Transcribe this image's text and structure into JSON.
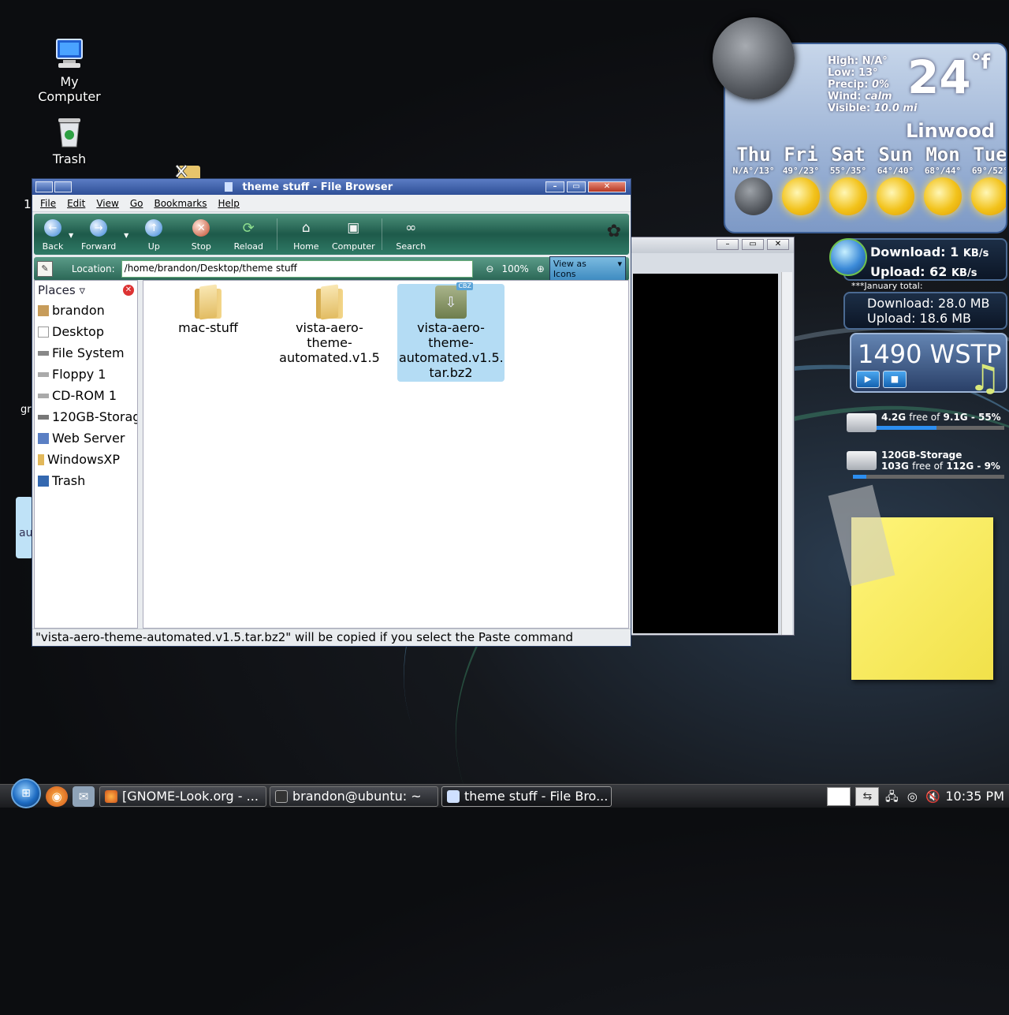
{
  "desktop": {
    "icons": [
      {
        "label": "My Computer"
      },
      {
        "label": "Trash"
      }
    ],
    "partial_labels": [
      "1",
      "gr",
      "au"
    ]
  },
  "window": {
    "title": "theme stuff - File Browser",
    "menu": [
      "File",
      "Edit",
      "View",
      "Go",
      "Bookmarks",
      "Help"
    ],
    "toolbar": {
      "back": "Back",
      "forward": "Forward",
      "up": "Up",
      "stop": "Stop",
      "reload": "Reload",
      "home": "Home",
      "computer": "Computer",
      "search": "Search"
    },
    "location": {
      "label": "Location:",
      "value": "/home/brandon/Desktop/theme stuff",
      "zoom": "100%",
      "view_as": "View as Icons"
    },
    "places": {
      "header": "Places",
      "items": [
        "brandon",
        "Desktop",
        "File System",
        "Floppy 1",
        "CD-ROM 1",
        "120GB-Storage",
        "Web Server",
        "WindowsXP",
        "Trash"
      ]
    },
    "files": [
      {
        "name": "mac-stuff",
        "kind": "folder"
      },
      {
        "name": "vista-aero-\ntheme-\nautomated.v1.5",
        "kind": "folder"
      },
      {
        "name": "vista-aero-\ntheme-\nautomated.v1.5.\ntar.bz2",
        "kind": "archive",
        "badge": "CBZ",
        "selected": true
      }
    ],
    "status": "\"vista-aero-theme-automated.v1.5.tar.bz2\" will be copied if you select the Paste command"
  },
  "weather": {
    "high": "High: N/A°",
    "low": "Low: 13°",
    "precip_label": "Precip:",
    "precip": "0%",
    "wind_label": "Wind:",
    "wind": "calm",
    "visible_label": "Visible:",
    "visible": "10.0 mi",
    "temp": "24",
    "unit": "°f",
    "city": "Linwood",
    "days": [
      {
        "name": "Thu",
        "temps": "N/A°/13°"
      },
      {
        "name": "Fri",
        "temps": "49°/23°"
      },
      {
        "name": "Sat",
        "temps": "55°/35°"
      },
      {
        "name": "Sun",
        "temps": "64°/40°"
      },
      {
        "name": "Mon",
        "temps": "68°/44°"
      },
      {
        "name": "Tue",
        "temps": "69°/52°"
      }
    ]
  },
  "network": {
    "download": "Download: 1",
    "download_unit": "KB/s",
    "upload": "Upload: 62",
    "upload_unit": "KB/s",
    "total_label": "***January total:",
    "total_download": "Download: 28.0 MB",
    "total_upload": "Upload: 18.6 MB"
  },
  "radio": {
    "station": "1490 WSTP"
  },
  "disks": [
    {
      "name": "",
      "free": "4.2G",
      "free_word": "free of",
      "total": "9.1G - 55%",
      "fill_percent": 55
    },
    {
      "name": "120GB-Storage",
      "free": "103G",
      "free_word": "free of",
      "total": "112G - 9%",
      "fill_percent": 9
    }
  ],
  "taskbar": {
    "tasks": [
      {
        "label": "[GNOME-Look.org - ...",
        "active": false
      },
      {
        "label": "brandon@ubuntu: ~",
        "active": false
      },
      {
        "label": "theme stuff - File Bro...",
        "active": true
      }
    ],
    "clock": "10:35 PM"
  },
  "colors": {
    "titlebar": "#2e4f96",
    "toolbar": "#1e5a4a",
    "selection": "#b4dcf4"
  }
}
